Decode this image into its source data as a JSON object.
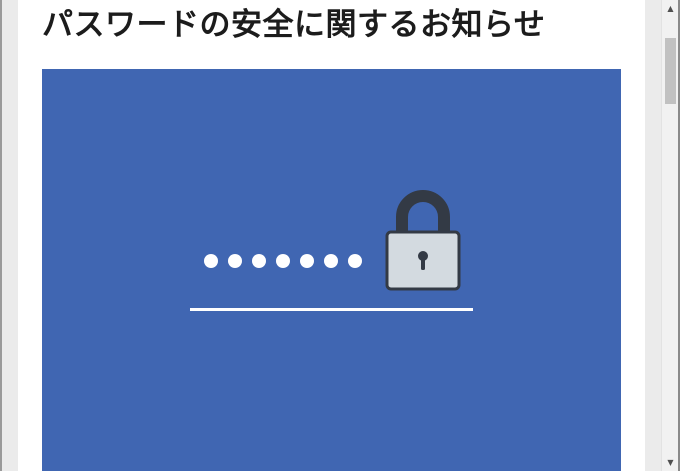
{
  "article": {
    "title": "パスワードの安全に関するお知らせ"
  },
  "hero_image": {
    "description_icon": "password-lock-illustration",
    "masked_password_dots": 7,
    "background_color": "#4066b2",
    "lock_body_color": "#d3dae0",
    "lock_outline_color": "#333a45"
  },
  "scrollbar": {
    "up_arrow": "▲",
    "down_arrow": "▼"
  }
}
